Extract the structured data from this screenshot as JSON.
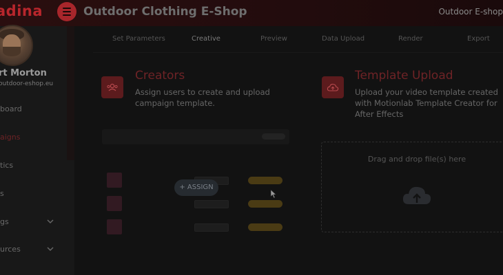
{
  "header": {
    "logo_text": "adina",
    "app_title": "Outdoor Clothing E-Shop",
    "shop_name": "Outdoor E-shop",
    "menu_icon": "hamburger-icon"
  },
  "sidebar": {
    "user_name": "rt Morton",
    "user_email": "outdoor-eshop.eu",
    "items": [
      {
        "label": "board"
      },
      {
        "label": "aigns"
      },
      {
        "label": "tics"
      },
      {
        "label": "s"
      },
      {
        "label": "gs"
      },
      {
        "label": "urces"
      }
    ]
  },
  "steps": [
    "Set Parameters",
    "Creative",
    "Preview",
    "Data Upload",
    "Render",
    "Export"
  ],
  "creators": {
    "title": "Creators",
    "description": "Assign users to create and upload campaign template.",
    "icon": "users-icon",
    "assign_button": "+ ASSIGN"
  },
  "template_upload": {
    "title": "Template Upload",
    "description": "Upload your video template created with Motionlab Template Creator for After Effects",
    "icon": "upload-cloud-icon",
    "dropzone_text": "Drag and drop file(s) here"
  },
  "colors": {
    "accent": "#a8262b",
    "overlay": "#000000"
  }
}
